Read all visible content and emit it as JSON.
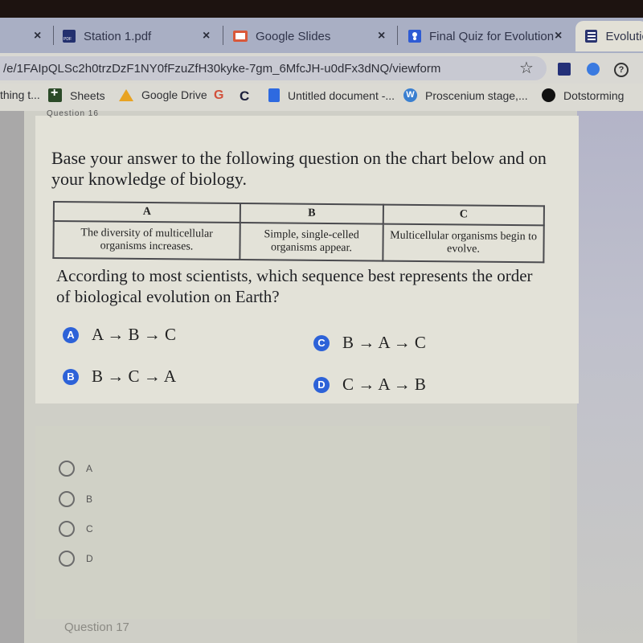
{
  "browser": {
    "tabs": [
      {
        "label": "",
        "icon": "unknown",
        "closable": true
      },
      {
        "label": "Station 1.pdf",
        "icon": "pdf-icon",
        "closable": true
      },
      {
        "label": "Google Slides",
        "icon": "slides-icon",
        "closable": true
      },
      {
        "label": "Final Quiz for Evolution",
        "icon": "classroom-icon",
        "closable": true
      },
      {
        "label": "Evolutic",
        "icon": "forms-icon",
        "active": true
      }
    ],
    "close_glyph": "×",
    "url": "/e/1FAIpQLSc2h0trzDzF1NY0fFzuZfH30kyke-7gm_6MfcJH-u0dFx3dNQ/viewform",
    "bookmark_star": "☆",
    "help_glyph": "?",
    "bookmarks": [
      {
        "label": "thing t...",
        "icon": "none"
      },
      {
        "label": "Sheets",
        "icon": "sheets-icon"
      },
      {
        "label": "Google Drive",
        "icon": "drive-icon"
      },
      {
        "label": "",
        "icon": "google-icon",
        "glyph": "G"
      },
      {
        "label": "",
        "icon": "c-icon",
        "glyph": "C"
      },
      {
        "label": "Untitled document -...",
        "icon": "docs-icon"
      },
      {
        "label": "Proscenium stage,...",
        "icon": "wordpress-icon",
        "glyph": "W"
      },
      {
        "label": "Dotstorming",
        "icon": "dot-icon"
      }
    ]
  },
  "question_card": {
    "faded_header": "Question 16",
    "prompt": "Base your answer to the following question on the chart below and on your knowledge of biology.",
    "table": {
      "headers": [
        "A",
        "B",
        "C"
      ],
      "cells": [
        "The diversity of multicellular organisms increases.",
        "Simple, single-celled organisms appear.",
        "Multicellular organisms begin to evolve."
      ]
    },
    "question": "According to most scientists, which sequence best represents the order of biological evolution on Earth?",
    "choices": [
      {
        "letter": "A",
        "text": "A → B → C"
      },
      {
        "letter": "B",
        "text": "B → C → A"
      },
      {
        "letter": "C",
        "text": "B → A → C"
      },
      {
        "letter": "D",
        "text": "C → A → B"
      }
    ],
    "badge_color": "#2d62d8"
  },
  "answer_options": [
    "A",
    "B",
    "C",
    "D"
  ],
  "next_question_label": "Question 17"
}
